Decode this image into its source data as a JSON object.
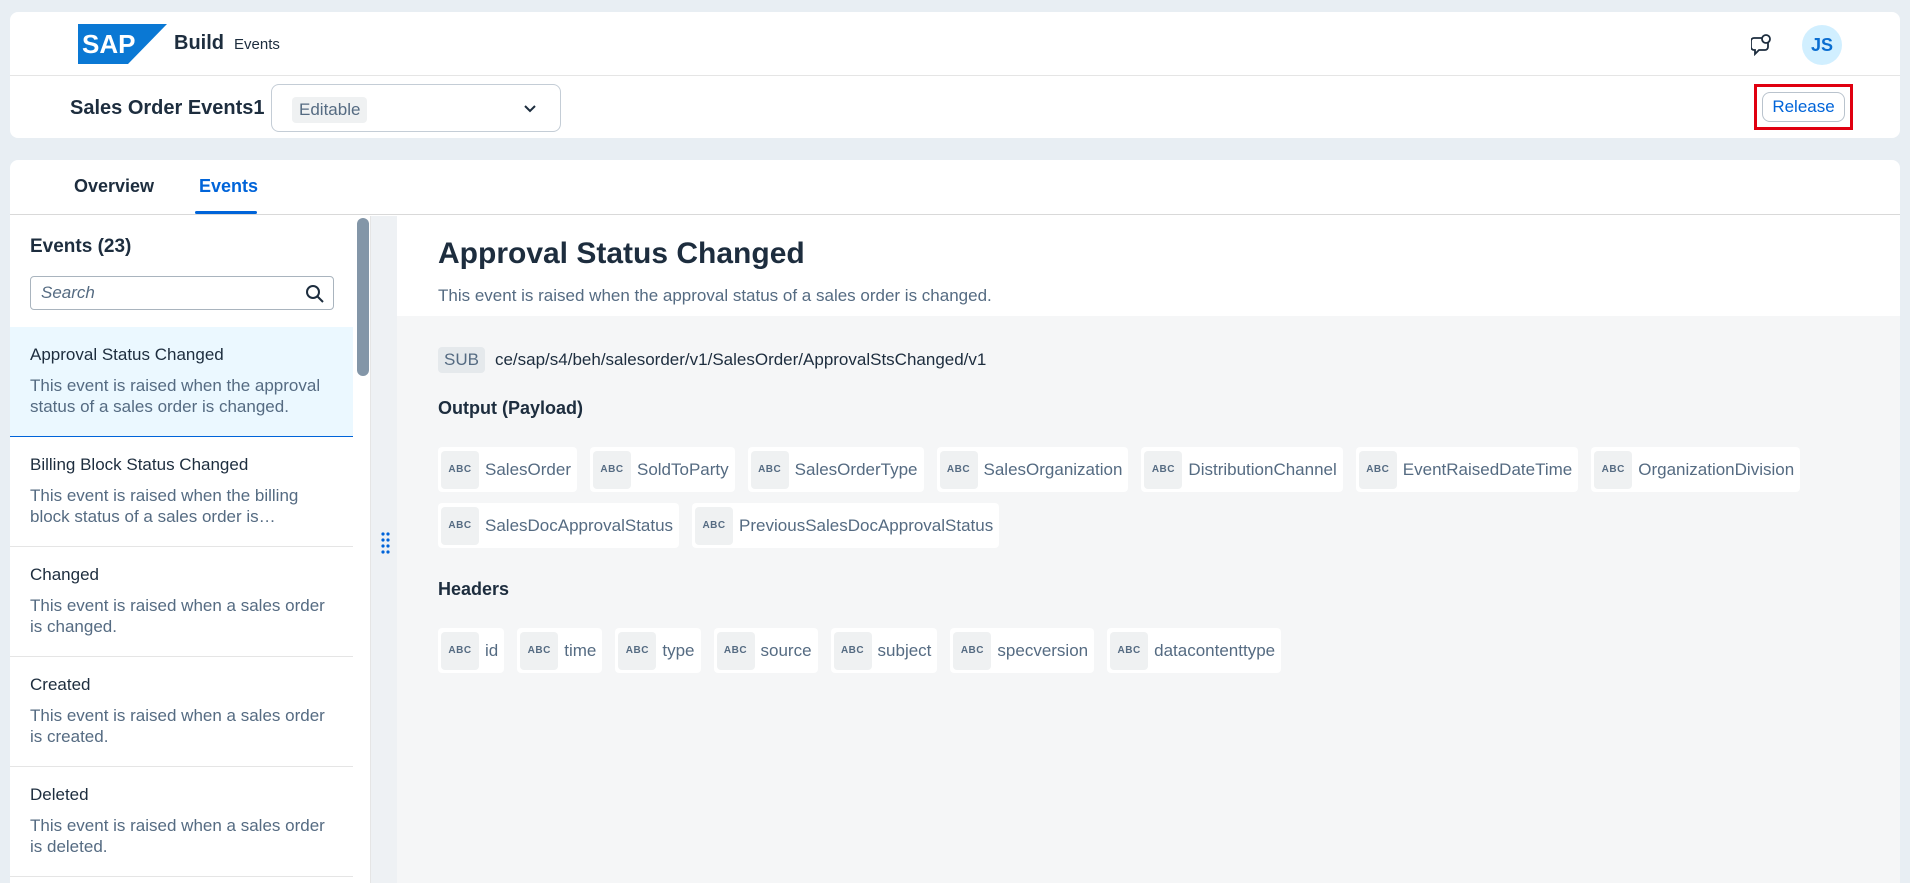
{
  "shell": {
    "logo_text": "SAP",
    "product_name": "Build",
    "product_sub": "Events",
    "avatar_initials": "JS"
  },
  "objbar": {
    "title": "Sales Order Events1",
    "state": "Editable",
    "release_label": "Release"
  },
  "tabs": [
    {
      "label": "Overview",
      "active": false
    },
    {
      "label": "Events",
      "active": true
    }
  ],
  "list": {
    "heading": "Events (23)",
    "search_placeholder": "Search",
    "items": [
      {
        "title": "Approval Status Changed",
        "desc": "This event is raised when the approval status of a sales order is changed.",
        "selected": true
      },
      {
        "title": "Billing Block Status Changed",
        "desc": "This event is raised when the billing block status of a sales order is…",
        "selected": false
      },
      {
        "title": "Changed",
        "desc": "This event is raised when a sales order is changed.",
        "selected": false
      },
      {
        "title": "Created",
        "desc": "This event is raised when a sales order is created.",
        "selected": false
      },
      {
        "title": "Deleted",
        "desc": "This event is raised when a sales order is deleted.",
        "selected": false
      }
    ]
  },
  "detail": {
    "title": "Approval Status Changed",
    "description": "This event is raised when the approval status of a sales order is changed.",
    "topic_tag": "SUB",
    "topic_path": "ce/sap/s4/beh/salesorder/v1/SalesOrder/ApprovalStsChanged/v1",
    "output_title": "Output (Payload)",
    "headers_title": "Headers",
    "type_icon_text": "ABC",
    "output_fields": [
      "SalesOrder",
      "SoldToParty",
      "SalesOrderType",
      "SalesOrganization",
      "DistributionChannel",
      "EventRaisedDateTime",
      "OrganizationDivision",
      "SalesDocApprovalStatus",
      "PreviousSalesDocApprovalStatus"
    ],
    "header_fields": [
      "id",
      "time",
      "type",
      "source",
      "subject",
      "specversion",
      "datacontenttype"
    ]
  },
  "colors": {
    "accent": "#0064d9",
    "highlight_frame": "#e00010",
    "selected_row": "#ebf8ff"
  }
}
